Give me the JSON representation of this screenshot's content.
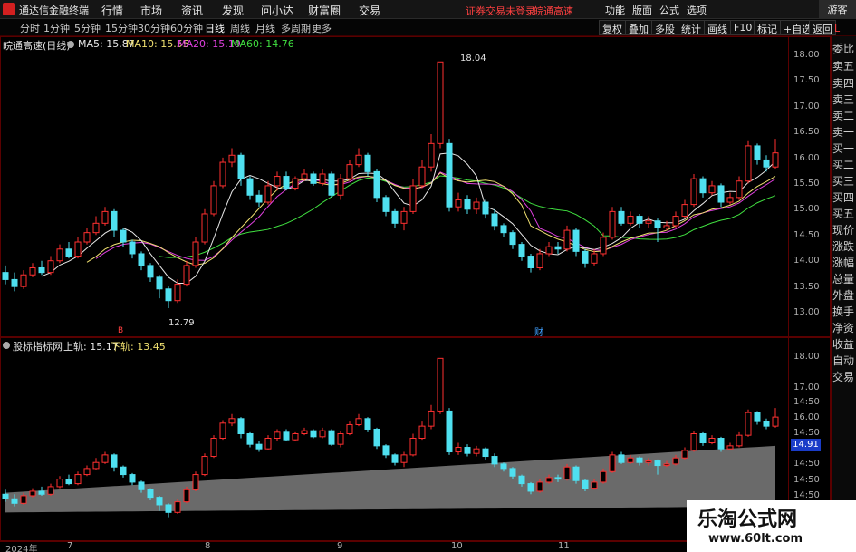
{
  "app": {
    "title": "通达信金融终端"
  },
  "menu": {
    "items": [
      "行情",
      "市场",
      "资讯",
      "发现",
      "问小达",
      "财富圈",
      "交易"
    ],
    "alert_red": [
      "证券交易未登录",
      "皖通高速"
    ],
    "right_items": [
      "功能",
      "版面",
      "公式",
      "选项"
    ],
    "guest_label": "游客"
  },
  "toolbar": {
    "periods": [
      "分时",
      "1分钟",
      "5分钟",
      "15分钟",
      "30分钟",
      "60分钟",
      "日线",
      "周线",
      "月线",
      "多周期",
      "更多"
    ],
    "active_period": "日线",
    "buttons": [
      "复权",
      "叠加",
      "多股",
      "统计",
      "画线",
      "F10",
      "标记",
      "+自选",
      "返回"
    ]
  },
  "main_pane": {
    "name": "皖通高速(日线)",
    "indicators": [
      {
        "label": "MA5: 15.87",
        "color": "#e8e8e8"
      },
      {
        "label": "MA10: 15.55",
        "color": "#f0e070"
      },
      {
        "label": "MA20: 15.19",
        "color": "#e040e0"
      },
      {
        "label": "MA60: 14.76",
        "color": "#40e040"
      }
    ],
    "high_label": "18.04",
    "low_label": "12.79",
    "event_marks": [
      "B",
      "财"
    ],
    "price_ticks": [
      "18.00",
      "17.50",
      "17.00",
      "16.50",
      "16.00",
      "15.50",
      "15.00",
      "14.50",
      "14.00",
      "13.50",
      "13.00"
    ]
  },
  "sub_pane": {
    "name": "股标指标网",
    "upper_label": "上轨: 15.17",
    "lower_label": "下轨: 13.45",
    "price_ticks": [
      "18.00",
      "17.00",
      "14:50",
      "16.00",
      "14:50",
      "14:50",
      "14:50",
      "14:50"
    ],
    "current_price": "14.91"
  },
  "side_panel": {
    "letter": "L",
    "items": [
      "委比",
      "卖五",
      "卖四",
      "卖三",
      "卖二",
      "卖一",
      "买一",
      "买二",
      "买三",
      "买四",
      "买五",
      "现价",
      "涨跌",
      "涨幅",
      "总量",
      "外盘",
      "换手",
      "净资",
      "收益",
      "自动",
      "交易"
    ]
  },
  "dates": [
    "2024年",
    "7",
    "8",
    "9",
    "10",
    "11"
  ],
  "watermark": {
    "title": "乐淘公式网",
    "url": "www.60lt.com"
  },
  "colors": {
    "up": "#ff3030",
    "down": "#4fe0f0",
    "grid_border": "#5a0000"
  },
  "chart_data": {
    "type": "candlestick",
    "title": "皖通高速(日线)",
    "ylim": [
      12.5,
      18.2
    ],
    "candles": [
      [
        13.55,
        13.4,
        13.7,
        13.3
      ],
      [
        13.4,
        13.25,
        13.55,
        13.15
      ],
      [
        13.25,
        13.5,
        13.6,
        13.2
      ],
      [
        13.5,
        13.65,
        13.75,
        13.45
      ],
      [
        13.65,
        13.55,
        13.8,
        13.5
      ],
      [
        13.55,
        13.8,
        13.9,
        13.5
      ],
      [
        13.8,
        14.05,
        14.15,
        13.75
      ],
      [
        14.05,
        13.9,
        14.2,
        13.85
      ],
      [
        13.9,
        14.2,
        14.3,
        13.85
      ],
      [
        14.2,
        14.4,
        14.5,
        14.15
      ],
      [
        14.4,
        14.6,
        14.75,
        14.35
      ],
      [
        14.6,
        14.85,
        14.95,
        14.55
      ],
      [
        14.85,
        14.45,
        14.9,
        14.3
      ],
      [
        14.45,
        14.2,
        14.5,
        14.1
      ],
      [
        14.2,
        13.95,
        14.25,
        13.85
      ],
      [
        13.95,
        13.7,
        14.0,
        13.6
      ],
      [
        13.7,
        13.45,
        13.75,
        13.35
      ],
      [
        13.45,
        13.2,
        13.5,
        13.0
      ],
      [
        13.2,
        12.95,
        13.25,
        12.79
      ],
      [
        12.95,
        13.3,
        13.4,
        12.9
      ],
      [
        13.3,
        13.7,
        13.8,
        13.25
      ],
      [
        13.7,
        14.2,
        14.3,
        13.65
      ],
      [
        14.2,
        14.8,
        14.9,
        14.15
      ],
      [
        14.8,
        15.4,
        15.5,
        14.75
      ],
      [
        15.4,
        15.9,
        16.0,
        15.35
      ],
      [
        15.9,
        16.05,
        16.2,
        15.8
      ],
      [
        16.05,
        15.55,
        16.1,
        15.4
      ],
      [
        15.55,
        15.2,
        15.6,
        15.1
      ],
      [
        15.2,
        15.05,
        15.3,
        14.95
      ],
      [
        15.05,
        15.4,
        15.5,
        15.0
      ],
      [
        15.4,
        15.6,
        15.7,
        15.3
      ],
      [
        15.6,
        15.35,
        15.7,
        15.3
      ],
      [
        15.35,
        15.55,
        15.6,
        15.3
      ],
      [
        15.55,
        15.65,
        15.75,
        15.5
      ],
      [
        15.65,
        15.45,
        15.7,
        15.4
      ],
      [
        15.45,
        15.65,
        15.75,
        15.4
      ],
      [
        15.65,
        15.2,
        15.7,
        15.15
      ],
      [
        15.2,
        15.55,
        15.65,
        15.1
      ],
      [
        15.55,
        15.85,
        15.95,
        15.5
      ],
      [
        15.85,
        16.05,
        16.2,
        15.8
      ],
      [
        16.05,
        15.7,
        16.1,
        15.6
      ],
      [
        15.7,
        15.15,
        15.75,
        15.05
      ],
      [
        15.15,
        14.85,
        15.2,
        14.75
      ],
      [
        14.85,
        14.6,
        14.9,
        14.5
      ],
      [
        14.6,
        14.85,
        14.95,
        14.45
      ],
      [
        14.85,
        15.4,
        15.55,
        14.8
      ],
      [
        15.4,
        15.8,
        15.95,
        15.35
      ],
      [
        15.8,
        16.3,
        16.5,
        15.7
      ],
      [
        16.3,
        18.04,
        18.04,
        16.2
      ],
      [
        16.3,
        14.95,
        16.4,
        14.85
      ],
      [
        14.95,
        15.1,
        15.25,
        14.85
      ],
      [
        15.1,
        14.9,
        15.2,
        14.8
      ],
      [
        14.9,
        15.05,
        15.15,
        14.8
      ],
      [
        15.05,
        14.8,
        15.1,
        14.7
      ],
      [
        14.8,
        14.55,
        14.9,
        14.45
      ],
      [
        14.55,
        14.4,
        14.6,
        14.3
      ],
      [
        14.4,
        14.15,
        14.45,
        14.05
      ],
      [
        14.15,
        13.9,
        14.2,
        13.8
      ],
      [
        13.9,
        13.65,
        13.95,
        13.55
      ],
      [
        13.65,
        13.95,
        14.05,
        13.6
      ],
      [
        13.95,
        14.1,
        14.2,
        13.9
      ],
      [
        14.1,
        14.05,
        14.2,
        13.95
      ],
      [
        14.05,
        14.45,
        14.55,
        14.0
      ],
      [
        14.45,
        14.0,
        14.5,
        13.9
      ],
      [
        14.0,
        13.75,
        14.05,
        13.65
      ],
      [
        13.75,
        13.95,
        14.05,
        13.7
      ],
      [
        13.95,
        14.3,
        14.4,
        13.9
      ],
      [
        14.3,
        14.85,
        14.95,
        14.25
      ],
      [
        14.85,
        14.6,
        14.95,
        14.55
      ],
      [
        14.6,
        14.75,
        14.85,
        14.55
      ],
      [
        14.75,
        14.6,
        14.8,
        14.5
      ],
      [
        14.6,
        14.65,
        14.75,
        14.5
      ],
      [
        14.65,
        14.5,
        14.7,
        14.2
      ],
      [
        14.5,
        14.55,
        14.65,
        14.45
      ],
      [
        14.55,
        14.75,
        14.85,
        14.5
      ],
      [
        14.75,
        15.0,
        15.1,
        14.7
      ],
      [
        15.0,
        15.55,
        15.65,
        14.95
      ],
      [
        15.55,
        15.25,
        15.6,
        15.15
      ],
      [
        15.25,
        15.4,
        15.5,
        15.2
      ],
      [
        15.4,
        15.05,
        15.45,
        14.95
      ],
      [
        15.05,
        15.15,
        15.25,
        15.0
      ],
      [
        15.15,
        15.5,
        15.6,
        15.1
      ],
      [
        15.5,
        16.25,
        16.35,
        15.45
      ],
      [
        16.25,
        15.95,
        16.3,
        15.85
      ],
      [
        15.95,
        15.8,
        16.05,
        15.7
      ],
      [
        15.8,
        16.1,
        16.4,
        15.75
      ]
    ]
  }
}
